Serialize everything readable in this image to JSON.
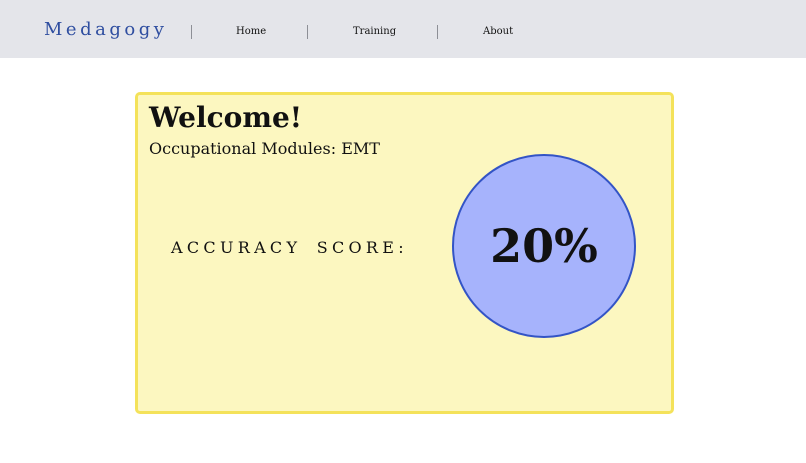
{
  "navbar": {
    "brand": "Medagogy",
    "links": [
      {
        "label": "Home"
      },
      {
        "label": "Training"
      },
      {
        "label": "About"
      }
    ]
  },
  "card": {
    "title": "Welcome!",
    "subtitle": "Occupational Modules: EMT",
    "score_label": "ACCURACY SCORE:",
    "score_value": "20%"
  },
  "colors": {
    "navbar_bg": "#e4e5ea",
    "brand": "#2f4ea0",
    "card_bg": "#fcf7c0",
    "card_border": "#f4e25a",
    "score_circle_fill": "#a6b3fc",
    "score_circle_border": "#3354c6"
  }
}
